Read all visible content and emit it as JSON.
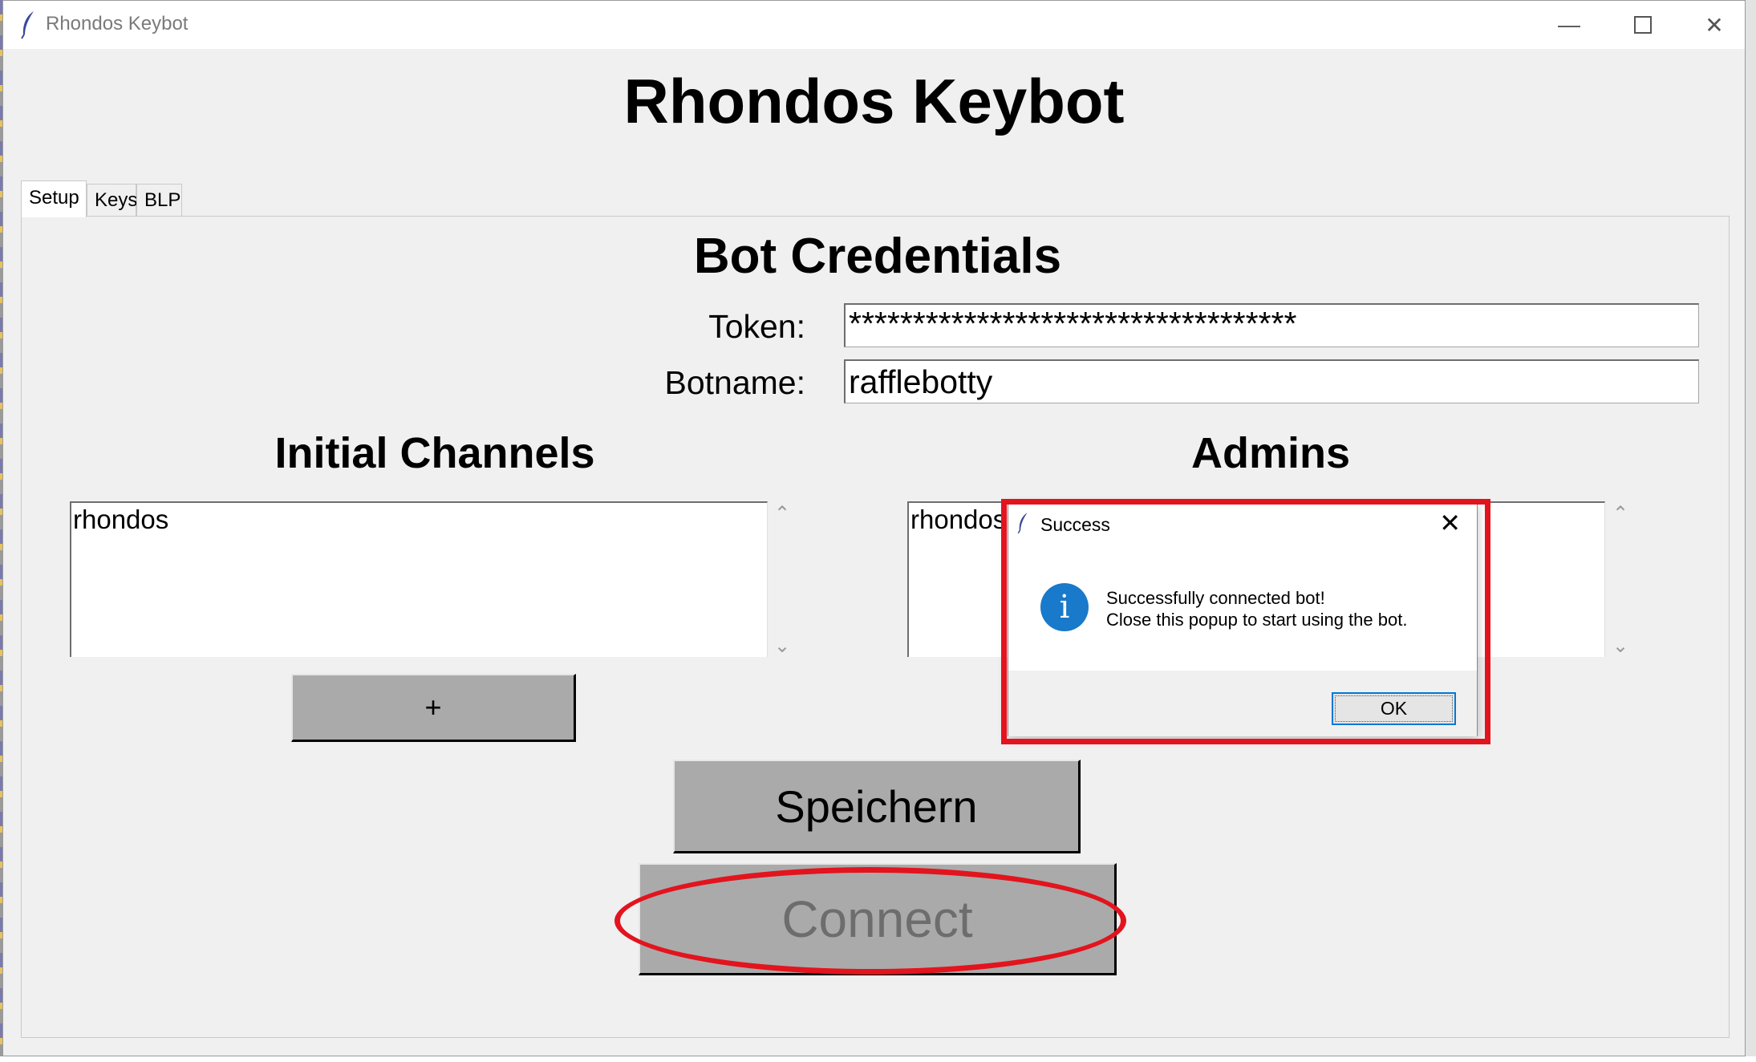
{
  "window": {
    "title": "Rhondos Keybot",
    "controls": [
      "minimize",
      "maximize",
      "close"
    ]
  },
  "app": {
    "title": "Rhondos Keybot"
  },
  "tabs": [
    {
      "label": "Setup",
      "active": true
    },
    {
      "label": "Keys",
      "active": false
    },
    {
      "label": "BLP",
      "active": false
    }
  ],
  "credentials": {
    "title": "Bot Credentials",
    "token_label": "Token:",
    "token_value": "***********************************",
    "botname_label": "Botname:",
    "botname_value": "rafflebotty"
  },
  "channels": {
    "title": "Initial Channels",
    "items": [
      "rhondos"
    ],
    "add_label": "+"
  },
  "admins": {
    "title": "Admins",
    "items": [
      "rhondos"
    ]
  },
  "actions": {
    "save_label": "Speichern",
    "connect_label": "Connect"
  },
  "dialog": {
    "title": "Success",
    "message_line1": "Successfully connected bot!",
    "message_line2": "Close this popup to start using the bot.",
    "ok_label": "OK"
  },
  "colors": {
    "annotation": "#e2141e",
    "info_icon": "#1979ca",
    "button": "#aaaaaa",
    "disabled_text": "#6d6d6d"
  }
}
